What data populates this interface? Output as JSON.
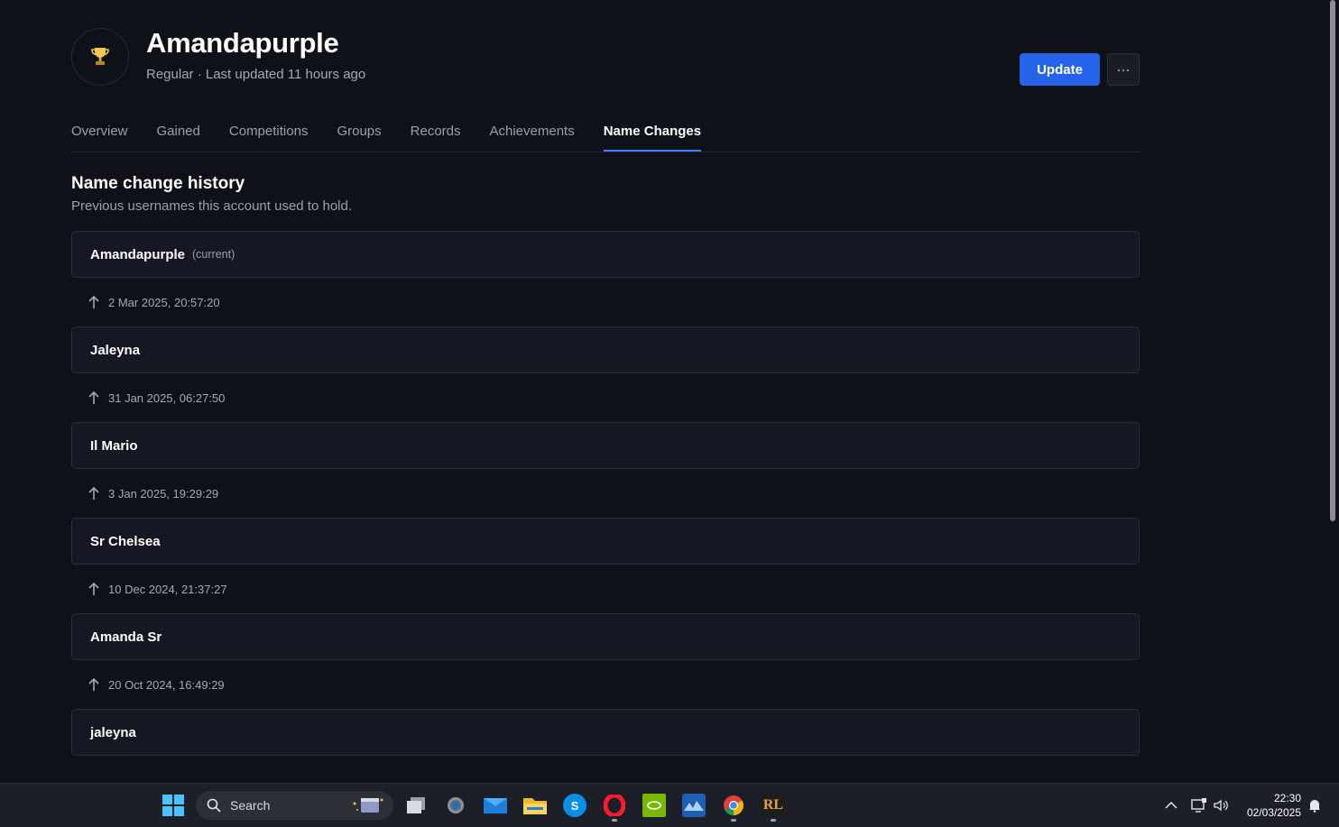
{
  "profile": {
    "username": "Amandapurple",
    "subtitle": "Regular · Last updated 11 hours ago",
    "update_label": "Update",
    "more_label": "···"
  },
  "tabs": [
    {
      "label": "Overview"
    },
    {
      "label": "Gained"
    },
    {
      "label": "Competitions"
    },
    {
      "label": "Groups"
    },
    {
      "label": "Records"
    },
    {
      "label": "Achievements"
    },
    {
      "label": "Name Changes",
      "active": true
    }
  ],
  "section": {
    "title": "Name change history",
    "subtitle": "Previous usernames this account used to hold."
  },
  "names": [
    {
      "name": "Amandapurple",
      "tag": "(current)"
    },
    {
      "name": "Jaleyna"
    },
    {
      "name": "Il Mario"
    },
    {
      "name": "Sr Chelsea"
    },
    {
      "name": "Amanda Sr"
    },
    {
      "name": "jaleyna"
    }
  ],
  "changes": [
    "2 Mar 2025, 20:57:20",
    "31 Jan 2025, 06:27:50",
    "3 Jan 2025, 19:29:29",
    "10 Dec 2024, 21:37:27",
    "20 Oct 2024, 16:49:29"
  ],
  "taskbar": {
    "search_label": "Search",
    "time": "22:30",
    "date": "02/03/2025",
    "apps": [
      "task-view-icon",
      "settings-icon",
      "mail-icon",
      "file-explorer-icon",
      "skype-icon",
      "opera-icon",
      "nvidia-icon",
      "photos-icon",
      "chrome-icon",
      "runelite-icon"
    ]
  },
  "colors": {
    "background": "#0f1119",
    "accent": "#2563eb",
    "tab_underline": "#3b82f6"
  }
}
